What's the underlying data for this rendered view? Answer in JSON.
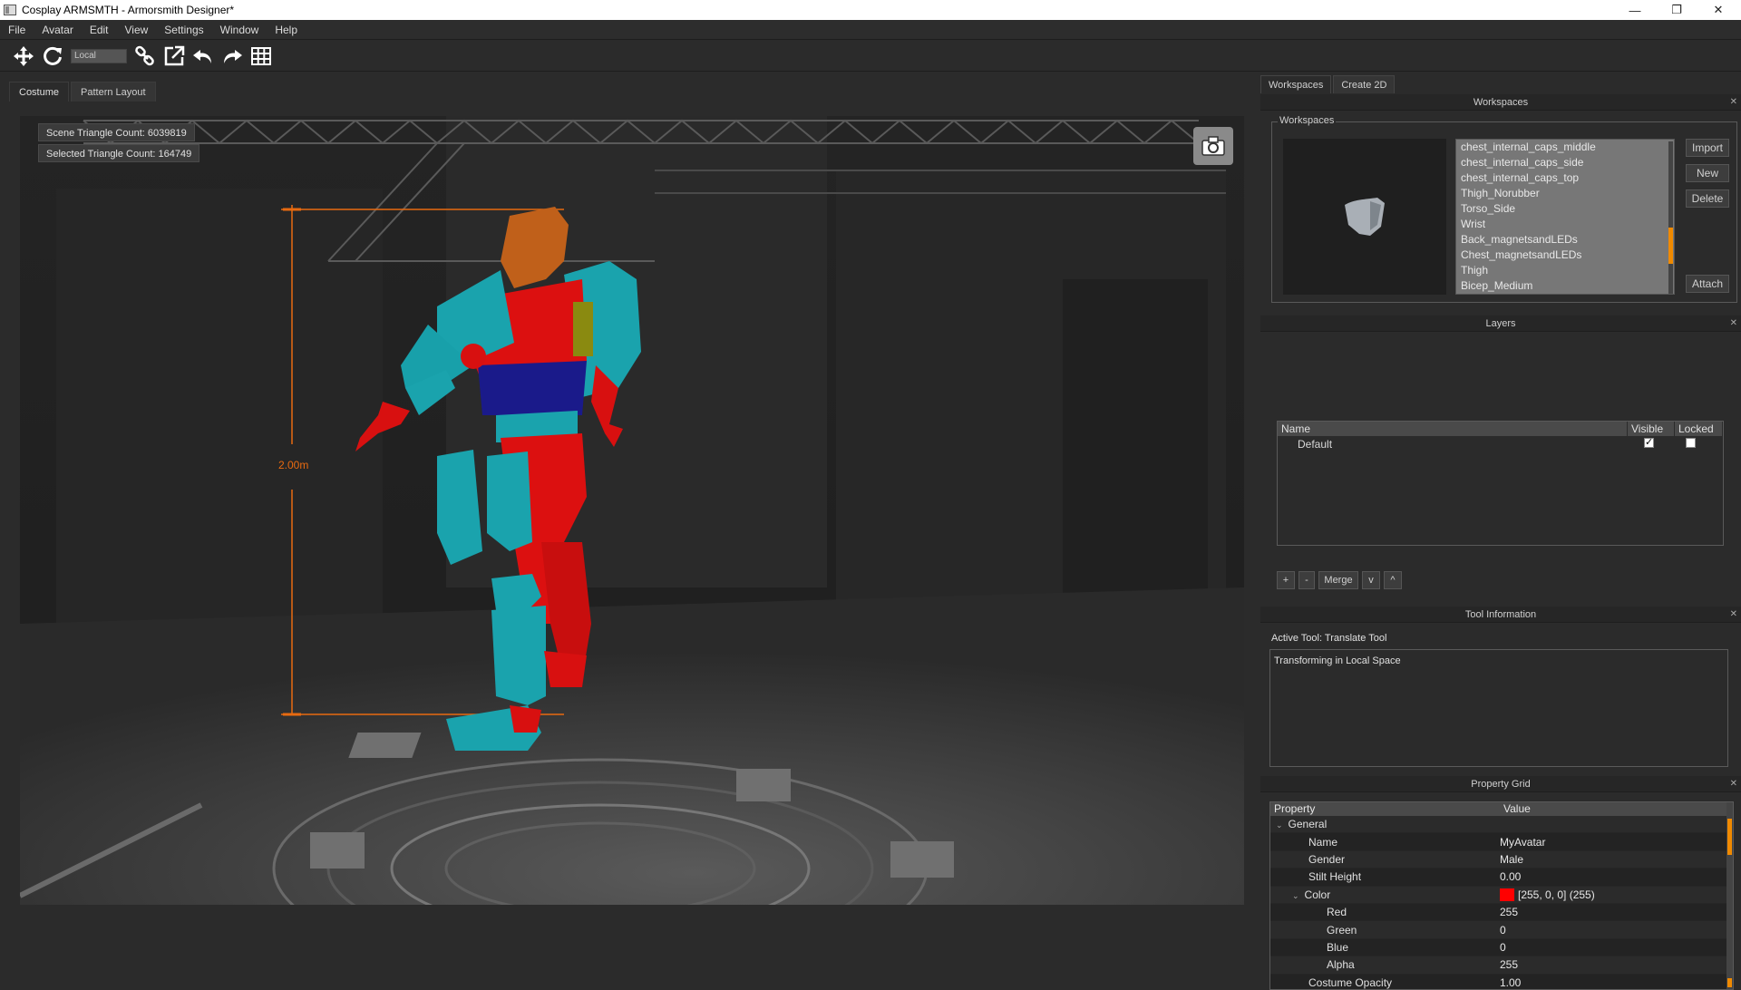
{
  "window": {
    "title": "Cosplay ARMSMTH - Armorsmith Designer*",
    "controls": [
      "—",
      "❐",
      "✕"
    ]
  },
  "menu": [
    "File",
    "Avatar",
    "Edit",
    "View",
    "Settings",
    "Window",
    "Help"
  ],
  "toolbar": {
    "space_mode": "Local"
  },
  "left_tabs": [
    "Costume",
    "Pattern Layout"
  ],
  "viewport": {
    "scene_triangle_count": "Scene Triangle Count: 6039819",
    "selected_triangle_count": "Selected Triangle Count: 164749",
    "height_label": "2.00m",
    "colors": {
      "measure": "#e86a10",
      "armor_teal": "#1aa3ad",
      "body_red": "#e01010",
      "belt_blue": "#1a1a8a",
      "helmet_orange": "#c0601a"
    }
  },
  "right_tabs": [
    "Workspaces",
    "Create 2D"
  ],
  "workspaces": {
    "header": "Workspaces",
    "group_title": "Workspaces",
    "items": [
      "chest_internal_caps_middle",
      "chest_internal_caps_side",
      "chest_internal_caps_top",
      "Thigh_Norubber",
      "Torso_Side",
      "Wrist",
      "Back_magnetsandLEDs",
      "Chest_magnetsandLEDs",
      "Thigh",
      "Bicep_Medium"
    ],
    "buttons": {
      "import": "Import",
      "new": "New",
      "delete": "Delete",
      "attach": "Attach"
    }
  },
  "layers": {
    "header": "Layers",
    "columns": {
      "name": "Name",
      "visible": "Visible",
      "locked": "Locked"
    },
    "rows": [
      {
        "name": "Default",
        "visible": true,
        "locked": false
      }
    ],
    "buttons": {
      "add": "+",
      "remove": "-",
      "merge": "Merge",
      "down": "v",
      "up": "^"
    }
  },
  "tool_info": {
    "header": "Tool Information",
    "active_tool": "Active Tool: Translate Tool",
    "description": "Transforming in Local Space"
  },
  "property_grid": {
    "header": "Property Grid",
    "columns": {
      "property": "Property",
      "value": "Value"
    },
    "rows": [
      {
        "property": "General",
        "value": "",
        "indent": 0,
        "expander": "⌄"
      },
      {
        "property": "Name",
        "value": "MyAvatar",
        "indent": 1
      },
      {
        "property": "Gender",
        "value": "Male",
        "indent": 1
      },
      {
        "property": "Stilt Height",
        "value": "0.00",
        "indent": 1
      },
      {
        "property": "Color",
        "value": "[255, 0, 0] (255)",
        "indent": 1,
        "expander": "⌄",
        "swatch": "#ff0000"
      },
      {
        "property": "Red",
        "value": "255",
        "indent": 2
      },
      {
        "property": "Green",
        "value": "0",
        "indent": 2
      },
      {
        "property": "Blue",
        "value": "0",
        "indent": 2
      },
      {
        "property": "Alpha",
        "value": "255",
        "indent": 2
      },
      {
        "property": "Costume Opacity",
        "value": "1.00",
        "indent": 1
      }
    ]
  }
}
